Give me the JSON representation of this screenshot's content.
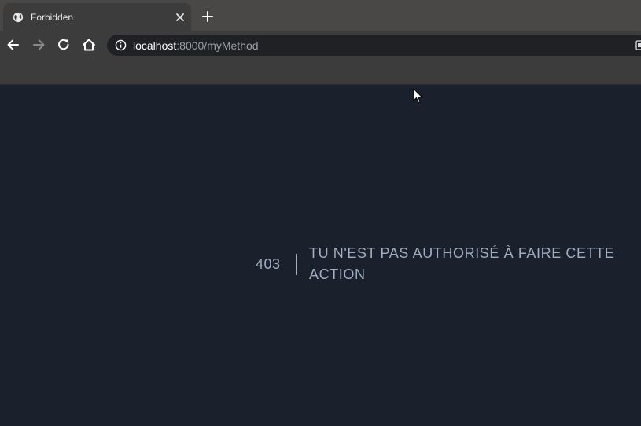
{
  "browser": {
    "tab": {
      "title": "Forbidden",
      "favicon": "globe-icon"
    },
    "address": {
      "host": "localhost",
      "rest": ":8000/myMethod"
    },
    "colors": {
      "tabstrip": "#4a4847",
      "toolbar": "#3c3c3c",
      "omnibox": "#202124"
    }
  },
  "page": {
    "error_code": "403",
    "error_message": "TU N'EST PAS AUTHORISÉ À FAIRE CETTE ACTION",
    "colors": {
      "background": "#1a202c",
      "text": "#a0aec0"
    }
  }
}
